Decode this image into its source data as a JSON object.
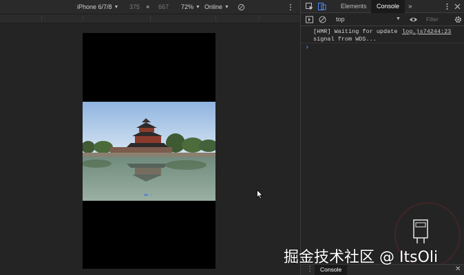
{
  "device_toolbar": {
    "device": "iPhone 6/7/8",
    "width": "375",
    "times": "×",
    "height": "667",
    "zoom": "72%",
    "network": "Online"
  },
  "devtools": {
    "tabs": [
      {
        "label": "Elements",
        "active": false
      },
      {
        "label": "Console",
        "active": true
      }
    ],
    "more": "»",
    "context": "top",
    "filter_placeholder": "Filter",
    "message": {
      "text": "[HMR] Waiting for update signal from WDS...",
      "source": "log.js74244:23"
    },
    "prompt": "›",
    "drawer_tab": "Console"
  },
  "watermark": "掘金技术社区 @ ItsOli",
  "colors": {
    "toolbar_bg": "#2a2a2a",
    "panel_bg": "#242424",
    "active_tab_bg": "#1a1a1a",
    "prompt_blue": "#5a9ff7",
    "carousel_dot": "#5f86c9"
  },
  "carousel": {
    "slide_count": 2,
    "active_index": 0
  }
}
